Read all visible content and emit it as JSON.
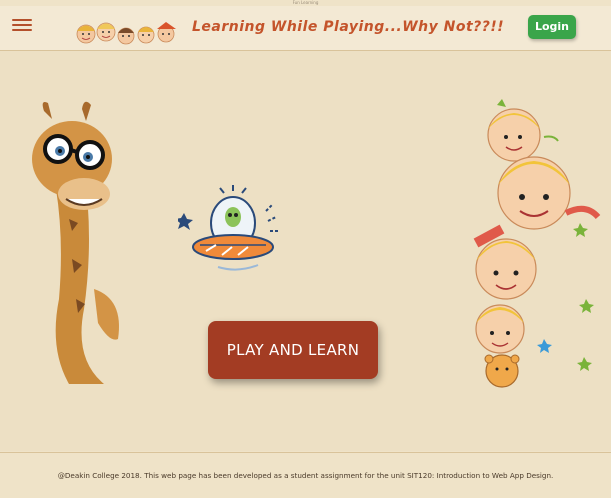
{
  "window": {
    "title_tiny": "Fun Learning"
  },
  "header": {
    "menu_icon": "hamburger-icon",
    "tagline": "Learning While Playing...Why Not??!!",
    "login_label": "Login",
    "login_color": "#3aa54a",
    "tagline_color": "#c4542b"
  },
  "main": {
    "play_button_label": "PLAY AND LEARN",
    "play_button_color": "#a33c23",
    "illustrations": [
      "giraffe-with-glasses",
      "alien-ufo",
      "stacked-kids"
    ]
  },
  "footer": {
    "text": "@Deakin College 2018. This web page has been developed as a student assignment for the unit SIT120: Introduction to Web App Design."
  }
}
